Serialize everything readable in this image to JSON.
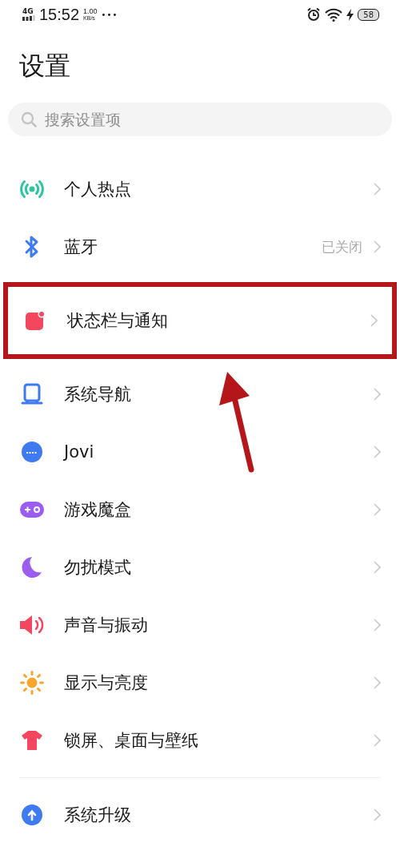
{
  "status_bar": {
    "network": "4G",
    "time": "15:52",
    "speed_value": "1.00",
    "speed_unit": "KB/s",
    "more": "•••",
    "battery": "58"
  },
  "title": "设置",
  "search": {
    "placeholder": "搜索设置项"
  },
  "sections": [
    {
      "items": [
        {
          "label": "个人热点",
          "highlighted": false
        },
        {
          "label": "蓝牙",
          "value": "已关闭",
          "highlighted": false
        },
        {
          "label": "状态栏与通知",
          "highlighted": true
        },
        {
          "label": "系统导航",
          "highlighted": false
        },
        {
          "label": "Jovi",
          "highlighted": false
        },
        {
          "label": "游戏魔盒",
          "highlighted": false
        },
        {
          "label": "勿扰模式",
          "highlighted": false
        },
        {
          "label": "声音与振动",
          "highlighted": false
        },
        {
          "label": "显示与亮度",
          "highlighted": false
        },
        {
          "label": "锁屏、桌面与壁纸",
          "highlighted": false
        }
      ]
    },
    {
      "items": [
        {
          "label": "系统升级",
          "highlighted": false
        }
      ]
    }
  ]
}
